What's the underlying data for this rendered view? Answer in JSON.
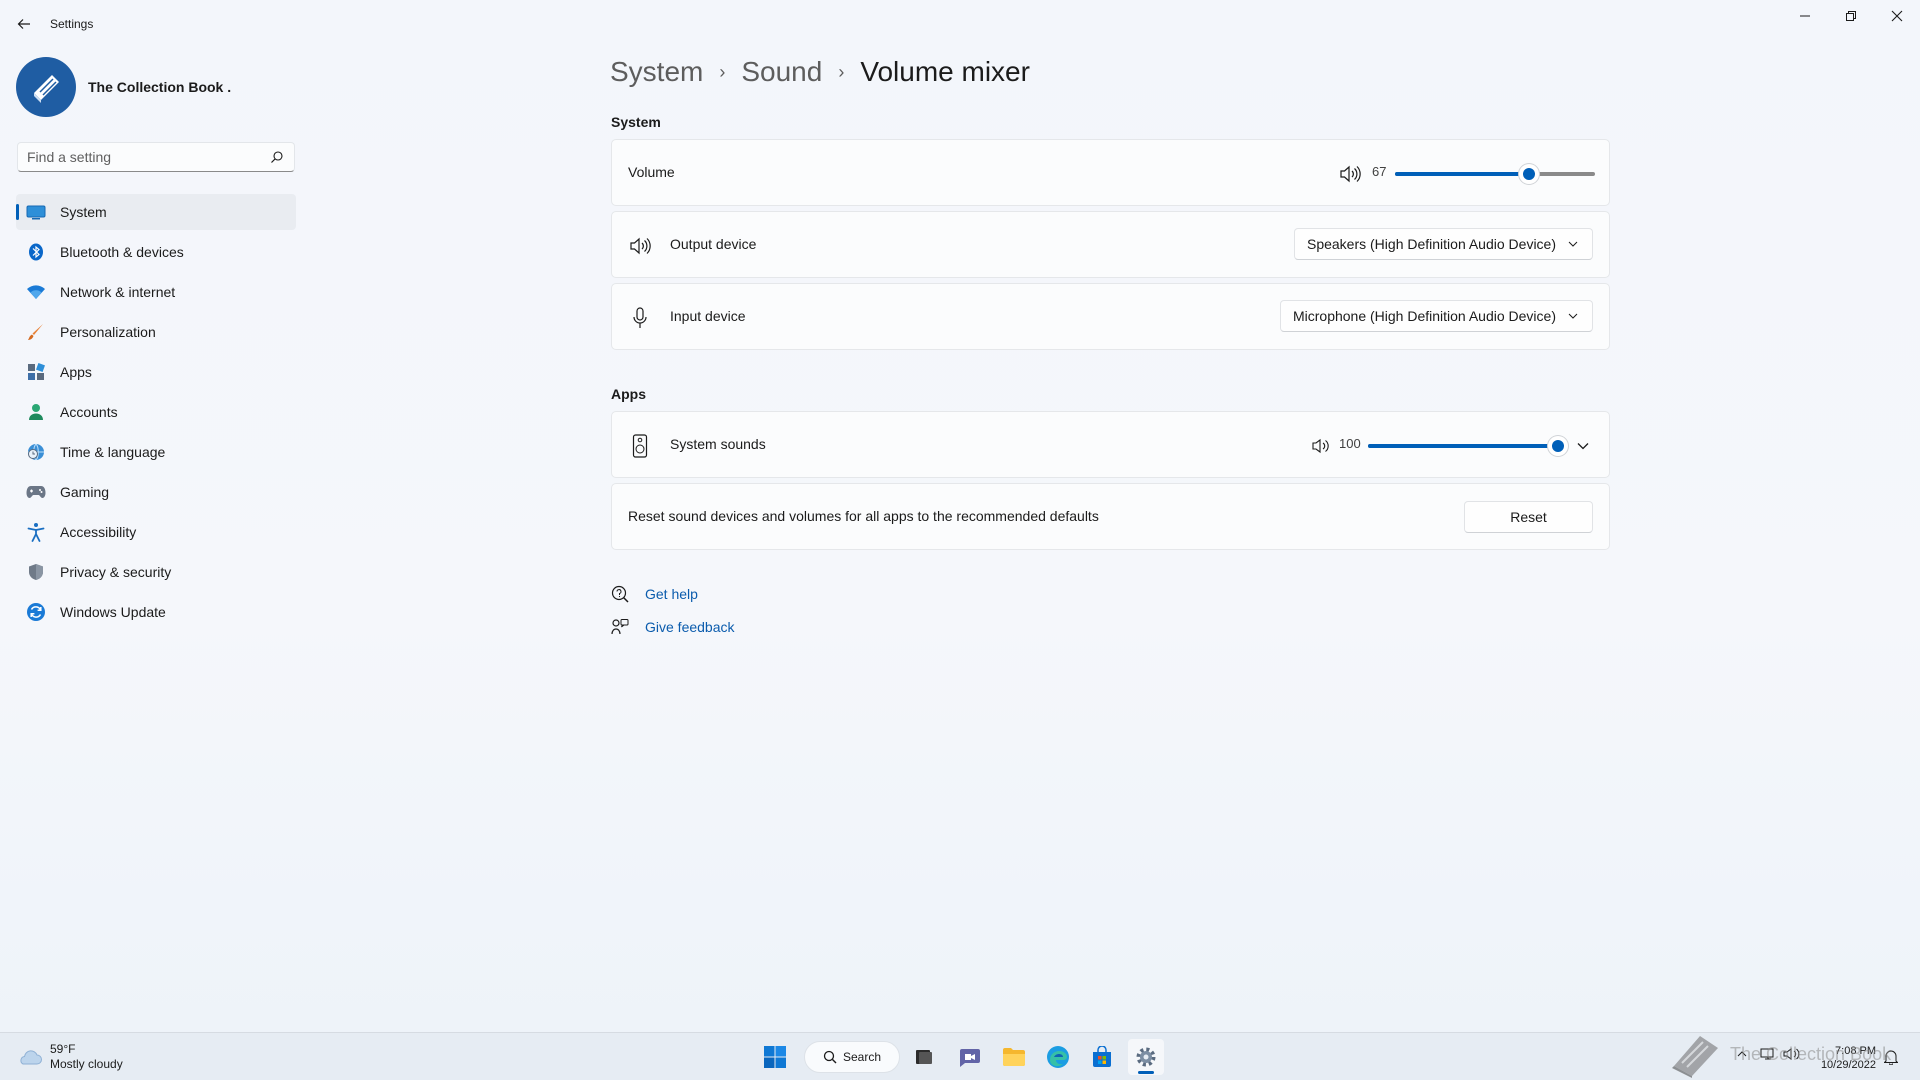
{
  "window": {
    "title": "Settings"
  },
  "profile": {
    "name": "The Collection Book ."
  },
  "search": {
    "placeholder": "Find a setting"
  },
  "nav": {
    "items": [
      {
        "label": "System",
        "icon": "display-icon"
      },
      {
        "label": "Bluetooth & devices",
        "icon": "bluetooth-icon"
      },
      {
        "label": "Network & internet",
        "icon": "wifi-icon"
      },
      {
        "label": "Personalization",
        "icon": "brush-icon"
      },
      {
        "label": "Apps",
        "icon": "apps-icon"
      },
      {
        "label": "Accounts",
        "icon": "person-icon"
      },
      {
        "label": "Time & language",
        "icon": "globe-clock-icon"
      },
      {
        "label": "Gaming",
        "icon": "gamepad-icon"
      },
      {
        "label": "Accessibility",
        "icon": "accessibility-icon"
      },
      {
        "label": "Privacy & security",
        "icon": "shield-icon"
      },
      {
        "label": "Windows Update",
        "icon": "update-icon"
      }
    ]
  },
  "breadcrumb": {
    "system": "System",
    "sound": "Sound",
    "current": "Volume mixer"
  },
  "system_section": {
    "title": "System",
    "volume": {
      "label": "Volume",
      "value": "67",
      "level": 0.67
    },
    "output": {
      "label": "Output device",
      "selected": "Speakers (High Definition Audio Device)"
    },
    "input": {
      "label": "Input device",
      "selected": "Microphone (High Definition Audio Device)"
    }
  },
  "apps_section": {
    "title": "Apps",
    "system_sounds": {
      "label": "System sounds",
      "value": "100",
      "level": 1.0
    },
    "reset": {
      "label": "Reset sound devices and volumes for all apps to the recommended defaults",
      "button": "Reset"
    }
  },
  "links": {
    "help": "Get help",
    "feedback": "Give feedback"
  },
  "taskbar": {
    "weather_temp": "59°F",
    "weather_desc": "Mostly cloudy",
    "search_label": "Search",
    "time": "7:08 PM",
    "date": "10/29/2022"
  },
  "watermark": {
    "text": "The Collection Book"
  },
  "colors": {
    "accent": "#005fb8",
    "link": "#0b5cad"
  }
}
